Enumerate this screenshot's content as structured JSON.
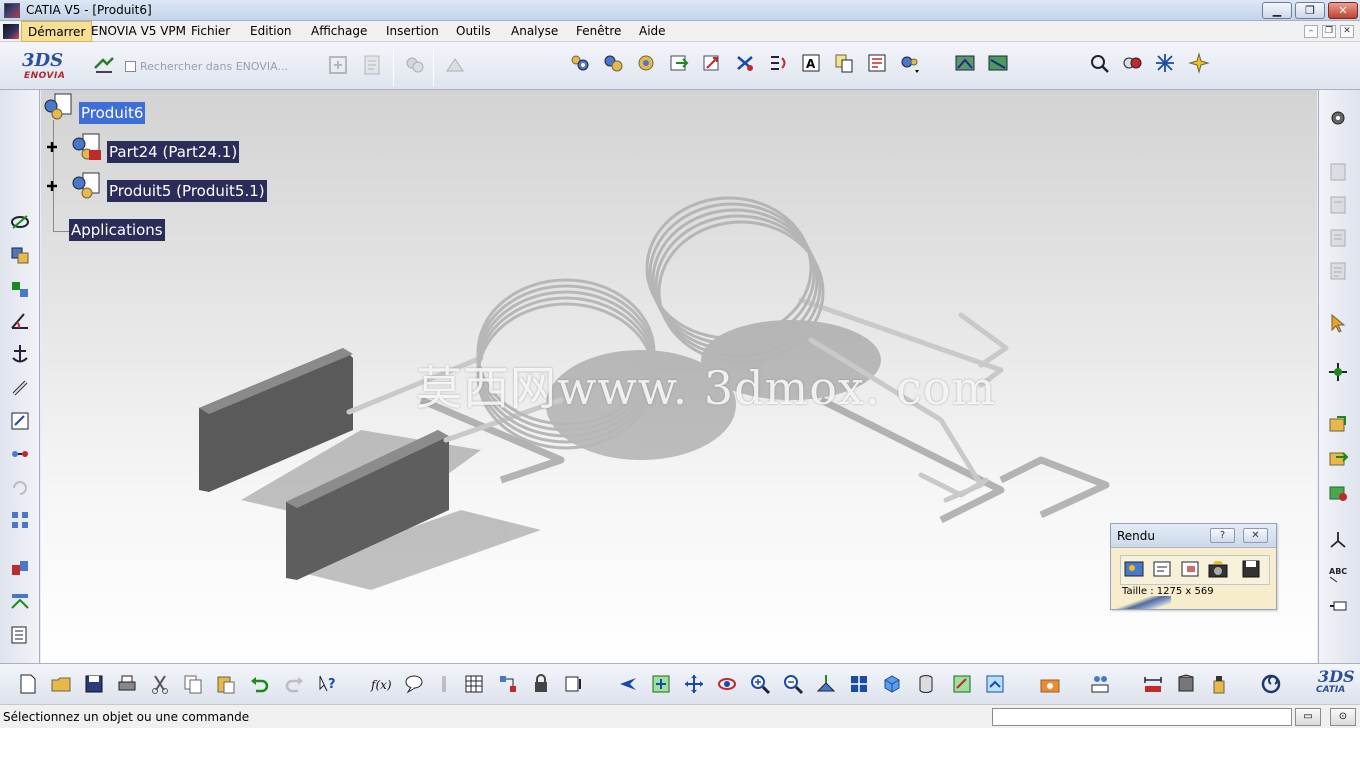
{
  "window": {
    "title": "CATIA V5 - [Produit6]",
    "minimize": "▁",
    "maximize": "❐",
    "close": "✕"
  },
  "menu": {
    "items": [
      "Démarrer",
      "ENOVIA V5 VPM",
      "Fichier",
      "Edition",
      "Affichage",
      "Insertion",
      "Outils",
      "Analyse",
      "Fenêtre",
      "Aide"
    ],
    "doc_minimize": "–",
    "doc_restore": "❐",
    "doc_close": "✕"
  },
  "toolbar": {
    "enovia_logo_ds": "3DS",
    "enovia_logo_text": "ENOVIA",
    "search_label": "Rechercher dans ENOVIA..."
  },
  "tree": {
    "root": "Produit6",
    "children": [
      "Part24 (Part24.1)",
      "Produit5 (Produit5.1)"
    ],
    "applications": "Applications"
  },
  "watermark": "莫西网www. 3dmox. com",
  "rendu": {
    "title": "Rendu",
    "help": "?",
    "close": "✕",
    "size_label": "Taille : 1275 x 569",
    "icons": [
      "render-image-icon",
      "render-settings-icon",
      "render-region-icon",
      "render-snapshot-icon",
      "render-save-icon"
    ]
  },
  "bottom": {
    "catia_logo_ds": "3DS",
    "catia_logo_text": "CATIA"
  },
  "status": {
    "text": "Sélectionnez un objet ou une commande",
    "command_value": ""
  },
  "colors": {
    "selection": "#3f6fd6",
    "tree_label_bg": "#2c2c5a",
    "menu_active": "#f7df95",
    "rendu_bg": "#f7edcd"
  }
}
